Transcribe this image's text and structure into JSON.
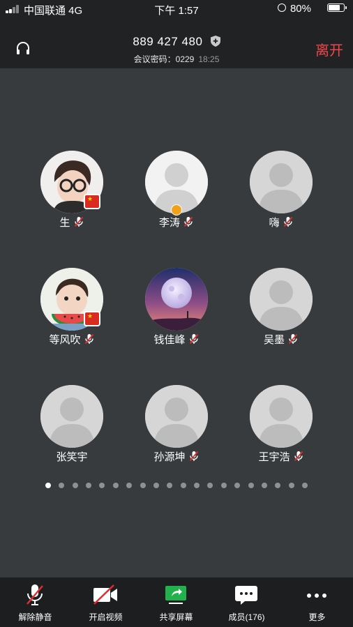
{
  "status": {
    "carrier": "中国联通 4G",
    "time": "下午 1:57",
    "battery": "80%",
    "battery_level": 0.8
  },
  "header": {
    "meeting_id": "889 427 480",
    "password_label": "会议密码：",
    "password": "0229",
    "elapsed": "18:25",
    "leave_label": "离开"
  },
  "participants": [
    {
      "name": "生",
      "muted": true,
      "avatar": "photo-boy-glasses",
      "flag": true
    },
    {
      "name": "李涛",
      "muted": true,
      "avatar": "placeholder-light",
      "host": true
    },
    {
      "name": "嗨",
      "muted": true,
      "avatar": "placeholder-grey"
    },
    {
      "name": "等风吹",
      "muted": true,
      "avatar": "photo-child-watermelon",
      "flag": true
    },
    {
      "name": "钱佳峰",
      "muted": true,
      "avatar": "photo-moon-sky"
    },
    {
      "name": "吴墨",
      "muted": true,
      "avatar": "placeholder-grey"
    },
    {
      "name": "张笑宇",
      "muted": false,
      "avatar": "placeholder-grey"
    },
    {
      "name": "孙源坤",
      "muted": true,
      "avatar": "placeholder-grey"
    },
    {
      "name": "王宇浩",
      "muted": true,
      "avatar": "placeholder-grey"
    }
  ],
  "pagination": {
    "pages": 20,
    "current": 1
  },
  "toolbar": {
    "unmute": "解除静音",
    "video": "开启视频",
    "share": "共享屏幕",
    "members": "成员(176)",
    "more": "更多"
  },
  "colors": {
    "background": "#373b3d",
    "bar": "#202224",
    "leave": "#f0474d",
    "share_green": "#23b14d",
    "mute_red": "#e02d2d"
  }
}
